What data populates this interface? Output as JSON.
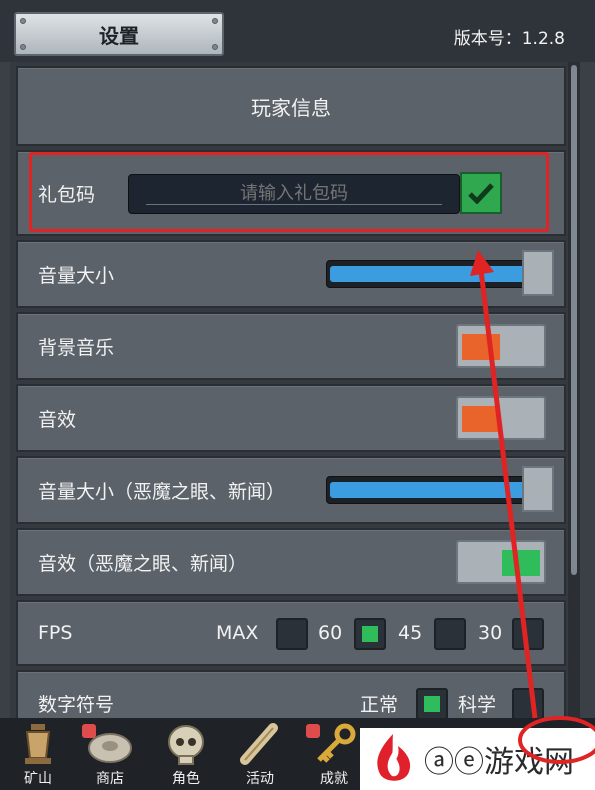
{
  "header": {
    "settings_tab": "设置",
    "version_label": "版本号：1.2.8"
  },
  "rows": {
    "player_info": "玩家信息",
    "gift_code": {
      "label": "礼包码",
      "placeholder": "请输入礼包码"
    },
    "volume": {
      "label": "音量大小",
      "level": 1.0
    },
    "bgm": {
      "label": "背景音乐",
      "state": "off"
    },
    "sfx": {
      "label": "音效",
      "state": "off"
    },
    "volume_evil_eye": {
      "label": "音量大小（恶魔之眼、新闻）",
      "level": 1.0
    },
    "sfx_evil_eye": {
      "label": "音效（恶魔之眼、新闻）",
      "state": "on"
    },
    "fps": {
      "label": "FPS",
      "options": [
        "MAX",
        "60",
        "45",
        "30"
      ],
      "selected": "60"
    },
    "number_format": {
      "label": "数字符号",
      "options": [
        "正常",
        "科学"
      ],
      "selected": "正常"
    }
  },
  "bottom_nav": [
    {
      "label": "矿山",
      "icon": "lantern-icon",
      "badge": false
    },
    {
      "label": "商店",
      "icon": "ore-rock-icon",
      "badge": true
    },
    {
      "label": "角色",
      "icon": "skull-icon",
      "badge": false
    },
    {
      "label": "活动",
      "icon": "scroll-icon",
      "badge": false
    },
    {
      "label": "成就",
      "icon": "key-icon",
      "badge": true
    }
  ],
  "watermark": {
    "text": "ⓐⓔ游戏网"
  },
  "colors": {
    "toggle_off": "#e8642a",
    "toggle_on": "#2fbc5b",
    "slider_fill": "#3b9ce0",
    "highlight": "#e02323"
  }
}
